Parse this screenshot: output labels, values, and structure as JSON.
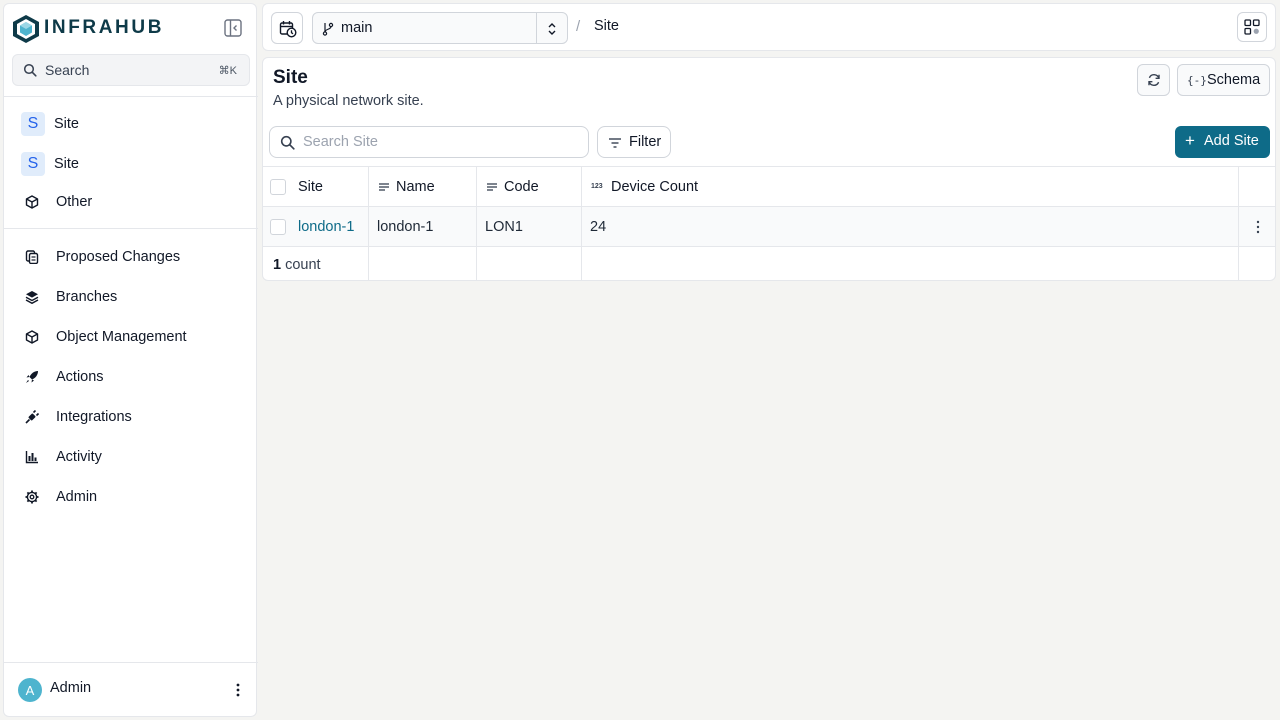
{
  "brand": {
    "name": "INFRAHUB",
    "accent": "#0e6b88"
  },
  "search": {
    "label": "Search",
    "shortcut": "⌘K"
  },
  "sidebar": {
    "pinned": [
      {
        "badge": "S",
        "label": "Site"
      },
      {
        "badge": "S",
        "label": "Site"
      },
      {
        "icon": "cube-icon",
        "label": "Other"
      }
    ],
    "items": [
      {
        "icon": "proposed-changes-icon",
        "label": "Proposed Changes"
      },
      {
        "icon": "layers-icon",
        "label": "Branches"
      },
      {
        "icon": "cube-icon",
        "label": "Object Management"
      },
      {
        "icon": "rocket-icon",
        "label": "Actions"
      },
      {
        "icon": "plug-icon",
        "label": "Integrations"
      },
      {
        "icon": "chart-icon",
        "label": "Activity"
      },
      {
        "icon": "gear-icon",
        "label": "Admin"
      }
    ]
  },
  "user": {
    "initial": "A",
    "name": "Admin"
  },
  "topbar": {
    "branch": "main",
    "breadcrumb": "Site"
  },
  "page": {
    "title": "Site",
    "description": "A physical network site.",
    "schema_label": "Schema",
    "search_placeholder": "Search Site",
    "filter_label": "Filter",
    "add_label": "Add Site"
  },
  "table": {
    "columns": [
      "Site",
      "Name",
      "Code",
      "Device Count"
    ],
    "rows": [
      {
        "site": "london-1",
        "name": "london-1",
        "code": "LON1",
        "device_count": "24"
      }
    ],
    "count": "1",
    "count_label": "count"
  }
}
